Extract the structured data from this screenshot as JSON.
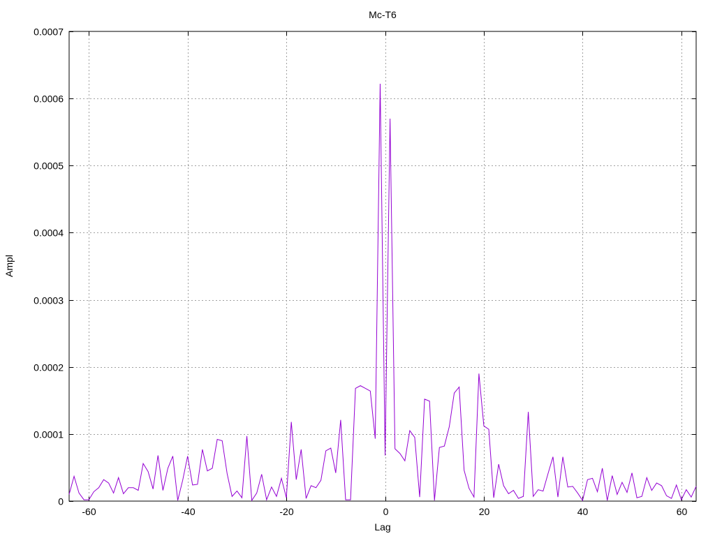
{
  "chart_data": {
    "type": "line",
    "title": "Mc-T6",
    "xlabel": "Lag",
    "ylabel": "Ampl",
    "xlim": [
      -64,
      63
    ],
    "ylim": [
      0,
      0.0007
    ],
    "grid": true,
    "line_color": "#9400d3",
    "x_ticks": [
      -60,
      -40,
      -20,
      0,
      20,
      40,
      60
    ],
    "x_tick_labels": [
      "-60",
      "-40",
      "-20",
      "0",
      "20",
      "40",
      "60"
    ],
    "y_ticks": [
      0,
      0.0001,
      0.0002,
      0.0003,
      0.0004,
      0.0005,
      0.0006,
      0.0007
    ],
    "y_tick_labels": [
      "0",
      "0.0001",
      "0.0002",
      "0.0003",
      "0.0004",
      "0.0005",
      "0.0006",
      "0.0007"
    ],
    "series": [
      {
        "x": [
          -64,
          -63,
          -62,
          -61,
          -60,
          -59,
          -58,
          -57,
          -56,
          -55,
          -54,
          -53,
          -52,
          -51,
          -50,
          -49,
          -48,
          -47,
          -46,
          -45,
          -44,
          -43,
          -42,
          -41,
          -40,
          -39,
          -38,
          -37,
          -36,
          -35,
          -34,
          -33,
          -32,
          -31,
          -30,
          -29,
          -28,
          -27,
          -26,
          -25,
          -24,
          -23,
          -22,
          -21,
          -20,
          -19,
          -18,
          -17,
          -16,
          -15,
          -14,
          -13,
          -12,
          -11,
          -10,
          -9,
          -8,
          -7,
          -6,
          -5,
          -4,
          -3,
          -2,
          -1,
          0,
          1,
          2,
          3,
          4,
          5,
          6,
          7,
          8,
          9,
          10,
          11,
          12,
          13,
          14,
          15,
          16,
          17,
          18,
          19,
          20,
          21,
          22,
          23,
          24,
          25,
          26,
          27,
          28,
          29,
          30,
          31,
          32,
          33,
          34,
          35,
          36,
          37,
          38,
          39,
          40,
          41,
          42,
          43,
          44,
          45,
          46,
          47,
          48,
          49,
          50,
          51,
          52,
          53,
          54,
          55,
          56,
          57,
          58,
          59,
          60,
          61,
          62,
          63
        ],
        "y": [
          1e-05,
          3.7e-05,
          1.2e-05,
          2e-06,
          2e-06,
          1.4e-05,
          2e-05,
          3.2e-05,
          2.7e-05,
          1.2e-05,
          3.5e-05,
          1.1e-05,
          2e-05,
          2e-05,
          1.6e-05,
          5.6e-05,
          4.4e-05,
          1.8e-05,
          6.8e-05,
          1.6e-05,
          4.9e-05,
          6.7e-05,
          1e-06,
          3.1e-05,
          6.7e-05,
          2.4e-05,
          2.5e-05,
          7.7e-05,
          4.5e-05,
          4.9e-05,
          9.2e-05,
          9e-05,
          4.1e-05,
          7e-06,
          1.5e-05,
          5e-06,
          9.7e-05,
          1e-06,
          1.2e-05,
          4e-05,
          2e-06,
          2.1e-05,
          7e-06,
          3.4e-05,
          5e-06,
          0.000118,
          3.2e-05,
          7.7e-05,
          4e-06,
          2.3e-05,
          2e-05,
          3.1e-05,
          7.5e-05,
          7.9e-05,
          4.2e-05,
          0.000121,
          2e-06,
          2e-06,
          0.000168,
          0.000172,
          0.000168,
          0.000164,
          9.3e-05,
          0.000622,
          6.8e-05,
          0.00057,
          7.8e-05,
          7.1e-05,
          6e-05,
          0.000105,
          9.5e-05,
          6e-06,
          0.000152,
          0.000149,
          1e-06,
          8e-05,
          8.2e-05,
          0.000111,
          0.000161,
          0.00017,
          4.6e-05,
          1.9e-05,
          6e-06,
          0.00019,
          0.000112,
          0.000107,
          5e-06,
          5.5e-05,
          2.3e-05,
          1.1e-05,
          1.6e-05,
          4e-06,
          7e-06,
          0.000133,
          7e-06,
          1.7e-05,
          1.5e-05,
          4.1e-05,
          6.6e-05,
          6e-06,
          6.6e-05,
          2.1e-05,
          2.2e-05,
          1.2e-05,
          1e-06,
          3.2e-05,
          3.4e-05,
          1.4e-05,
          4.9e-05,
          1e-06,
          3.8e-05,
          1e-05,
          2.8e-05,
          1.3e-05,
          4.2e-05,
          5e-06,
          7e-06,
          3.5e-05,
          1.6e-05,
          2.7e-05,
          2.3e-05,
          8e-06,
          4e-06,
          2.4e-05,
          2e-06,
          1.7e-05,
          6e-06,
          2.2e-05
        ]
      }
    ]
  }
}
